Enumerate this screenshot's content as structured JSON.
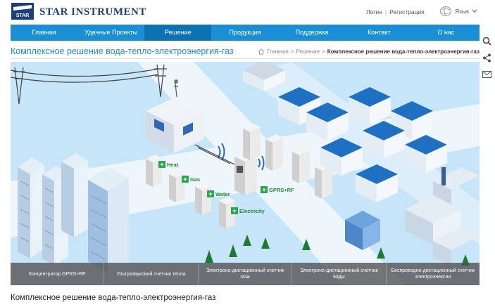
{
  "header": {
    "brand": "STAR INSTRUMENT",
    "logo_text": "STAR",
    "login": "Логин",
    "register": "Регистрация",
    "language": "Язык"
  },
  "nav": [
    "Главная",
    "Удачные Проекты",
    "Решение",
    "Продукция",
    "Поддержка",
    "Контакт",
    "О нас"
  ],
  "page": {
    "title": "Комплексное решение вода-тепло-электроэнергия-газ",
    "breadcrumb": [
      "Главная",
      "Решение"
    ],
    "breadcrumb_current": "Комплексное решение вода-тепло-электроэнергия-газ",
    "bottom_title": "Комплексное решение вода-тепло-электроэнергия-газ"
  },
  "scene_labels": {
    "heat": "Heat",
    "gas": "Gas",
    "water": "Water",
    "electricity": "Electricity",
    "gprs": "GPRS+RF"
  },
  "captions": [
    "Концентратор GPRS+RF",
    "Ультразвуковой счетчик тепла",
    "Электроно-дистационный счетчик газа",
    "Электроно-дистационный счетчик воды",
    "Беспроводно-дистационный счетчик электроэнергии"
  ],
  "colors": {
    "accent": "#1a8fd6",
    "nav_active": "#0d72b3",
    "brand": "#1b3f7a",
    "scene_bg": "#c6e5f8",
    "label_green": "#2ea44f"
  },
  "icons": [
    "globe-icon",
    "chevron-down-icon",
    "search-icon",
    "share-icon",
    "mail-icon",
    "home-icon"
  ]
}
